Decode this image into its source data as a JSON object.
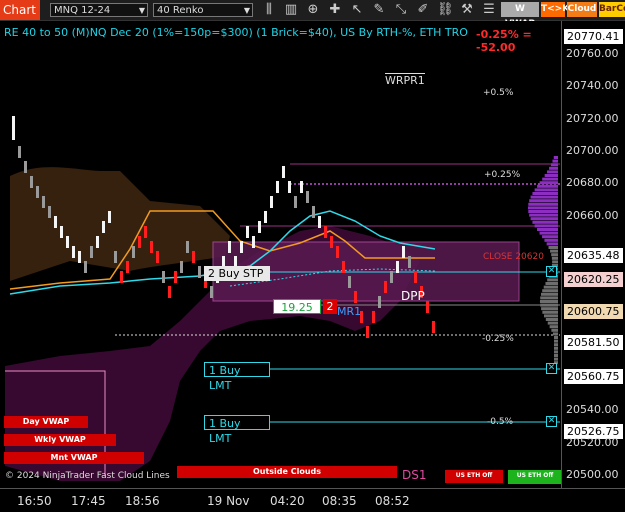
{
  "toolbar": {
    "chart_tab": "Chart",
    "instrument": "MNQ 12-24",
    "bar_type": "40 Renko",
    "buttons": {
      "wvwap": "W VWAP",
      "tk": "T<>K",
      "cloud": "Cloud",
      "barco": "BarCo"
    }
  },
  "chart": {
    "title": "RE 40 to 50 (M)NQ Dec 20 (1%=150p=$300) (1 Brick=$40), US By RTH-%, ETH TRO",
    "pnl": "-0.25% = -52.00",
    "labels": {
      "wrpr1": "WRPR1",
      "plus05": "+0.5%",
      "plus025": "+0.25%",
      "close": "CLOSE 20620",
      "dpp": "DPP",
      "mr1": "MR1",
      "minus025": "-0.25%",
      "minus05": "-0.5%",
      "ds1": "DS1",
      "us_eth_off_1": "US ETH Off",
      "us_eth_off_2": "US ETH Off",
      "ninja_clouds": "© 2024 NinjaTrader Fast Cloud Lines",
      "outside_clouds": "Outside Clouds"
    },
    "orders": {
      "buy_stp": "2 Buy STP",
      "buy_stp_price": "19.25",
      "buy_stp_qty": "2",
      "buy_lmt_1": "1 Buy LMT",
      "buy_lmt_2": "1 Buy LMT"
    },
    "vwap_buttons": [
      "Day VWAP",
      "Wkly VWAP",
      "Mnt VWAP"
    ]
  },
  "price_axis": {
    "labels": [
      "20770.41",
      "20760.00",
      "20740.00",
      "20720.00",
      "20700.00",
      "20680.00",
      "20660.00",
      "20635.48",
      "20620.25",
      "20600.75",
      "20581.50",
      "20560.75",
      "20540.00",
      "20526.75",
      "20520.00",
      "20500.00"
    ],
    "colors": {
      "20770.41": "#ffffff",
      "20635.48": "#ffffff",
      "20620.25": "#f4d0d0",
      "20600.75": "#f1d9b2",
      "20581.50": "#ffffff",
      "20560.75": "#ffffff",
      "20526.75": "#ffffff"
    }
  },
  "time_axis": {
    "labels": [
      "16:50",
      "17:45",
      "18:56",
      "19 Nov",
      "04:20",
      "08:35",
      "08:52"
    ]
  },
  "colors": {
    "accent_red": "#e53b16",
    "cyan": "#2fd9e8",
    "orange": "#f39a1f",
    "magenta": "#a04bb3"
  }
}
